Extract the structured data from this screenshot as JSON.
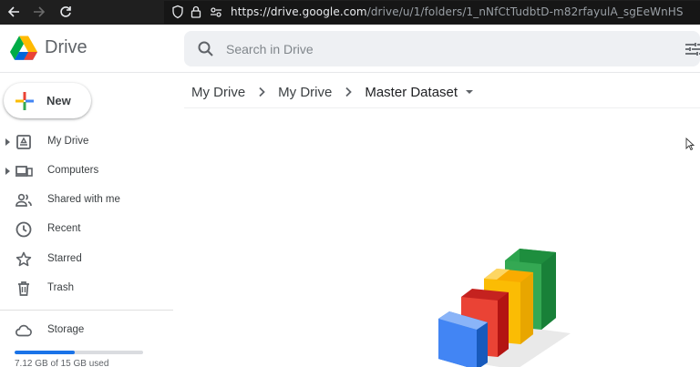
{
  "browser": {
    "url_host": "https://drive.google.com",
    "url_path": "/drive/u/1/folders/1_nNfCtTudbtD-m82rfayulA_sgEeWnHS"
  },
  "header": {
    "app_name": "Drive",
    "search_placeholder": "Search in Drive"
  },
  "sidebar": {
    "new_label": "New",
    "items": [
      {
        "label": "My Drive",
        "icon": "my-drive-icon",
        "expandable": true
      },
      {
        "label": "Computers",
        "icon": "computers-icon",
        "expandable": true
      },
      {
        "label": "Shared with me",
        "icon": "shared-icon",
        "expandable": false
      },
      {
        "label": "Recent",
        "icon": "clock-icon",
        "expandable": false
      },
      {
        "label": "Starred",
        "icon": "star-icon",
        "expandable": false
      },
      {
        "label": "Trash",
        "icon": "trash-icon",
        "expandable": false
      }
    ],
    "storage": {
      "label": "Storage",
      "usage_text": "7.12 GB of 15 GB used",
      "used_fraction": 0.47
    }
  },
  "breadcrumb": {
    "items": [
      "My Drive",
      "My Drive",
      "Master Dataset"
    ]
  },
  "colors": {
    "accent": "#1a73e8",
    "browser_bg": "#1f1f1f"
  }
}
